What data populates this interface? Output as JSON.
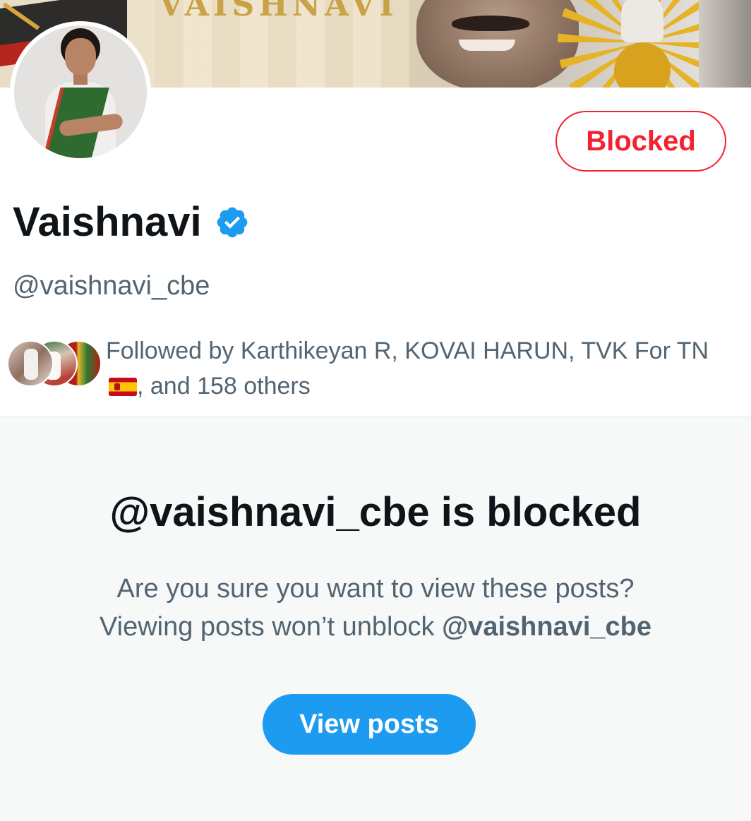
{
  "banner": {
    "art_text": "VAISHNAVI"
  },
  "profile": {
    "display_name": "Vaishnavi",
    "handle": "@vaishnavi_cbe",
    "blocked_button_label": "Blocked",
    "verified_icon": "verified-badge-icon",
    "verified_color": "#1d9bf0",
    "followed_by": {
      "prefix": "Followed by Karthikeyan R, KOVAI HARUN, TVK For TN",
      "flag": "spain-flag-emoji",
      "suffix": ", and 158 others"
    }
  },
  "blocked_notice": {
    "title": "@vaishnavi_cbe is blocked",
    "line1": "Are you sure you want to view these posts?",
    "line2_prefix": "Viewing posts won’t unblock ",
    "line2_handle": "@vaishnavi_cbe",
    "view_button_label": "View posts"
  },
  "colors": {
    "accent": "#1d9bf0",
    "blocked_red": "#f4212e",
    "text_primary": "#0f1419",
    "text_secondary": "#536471"
  }
}
